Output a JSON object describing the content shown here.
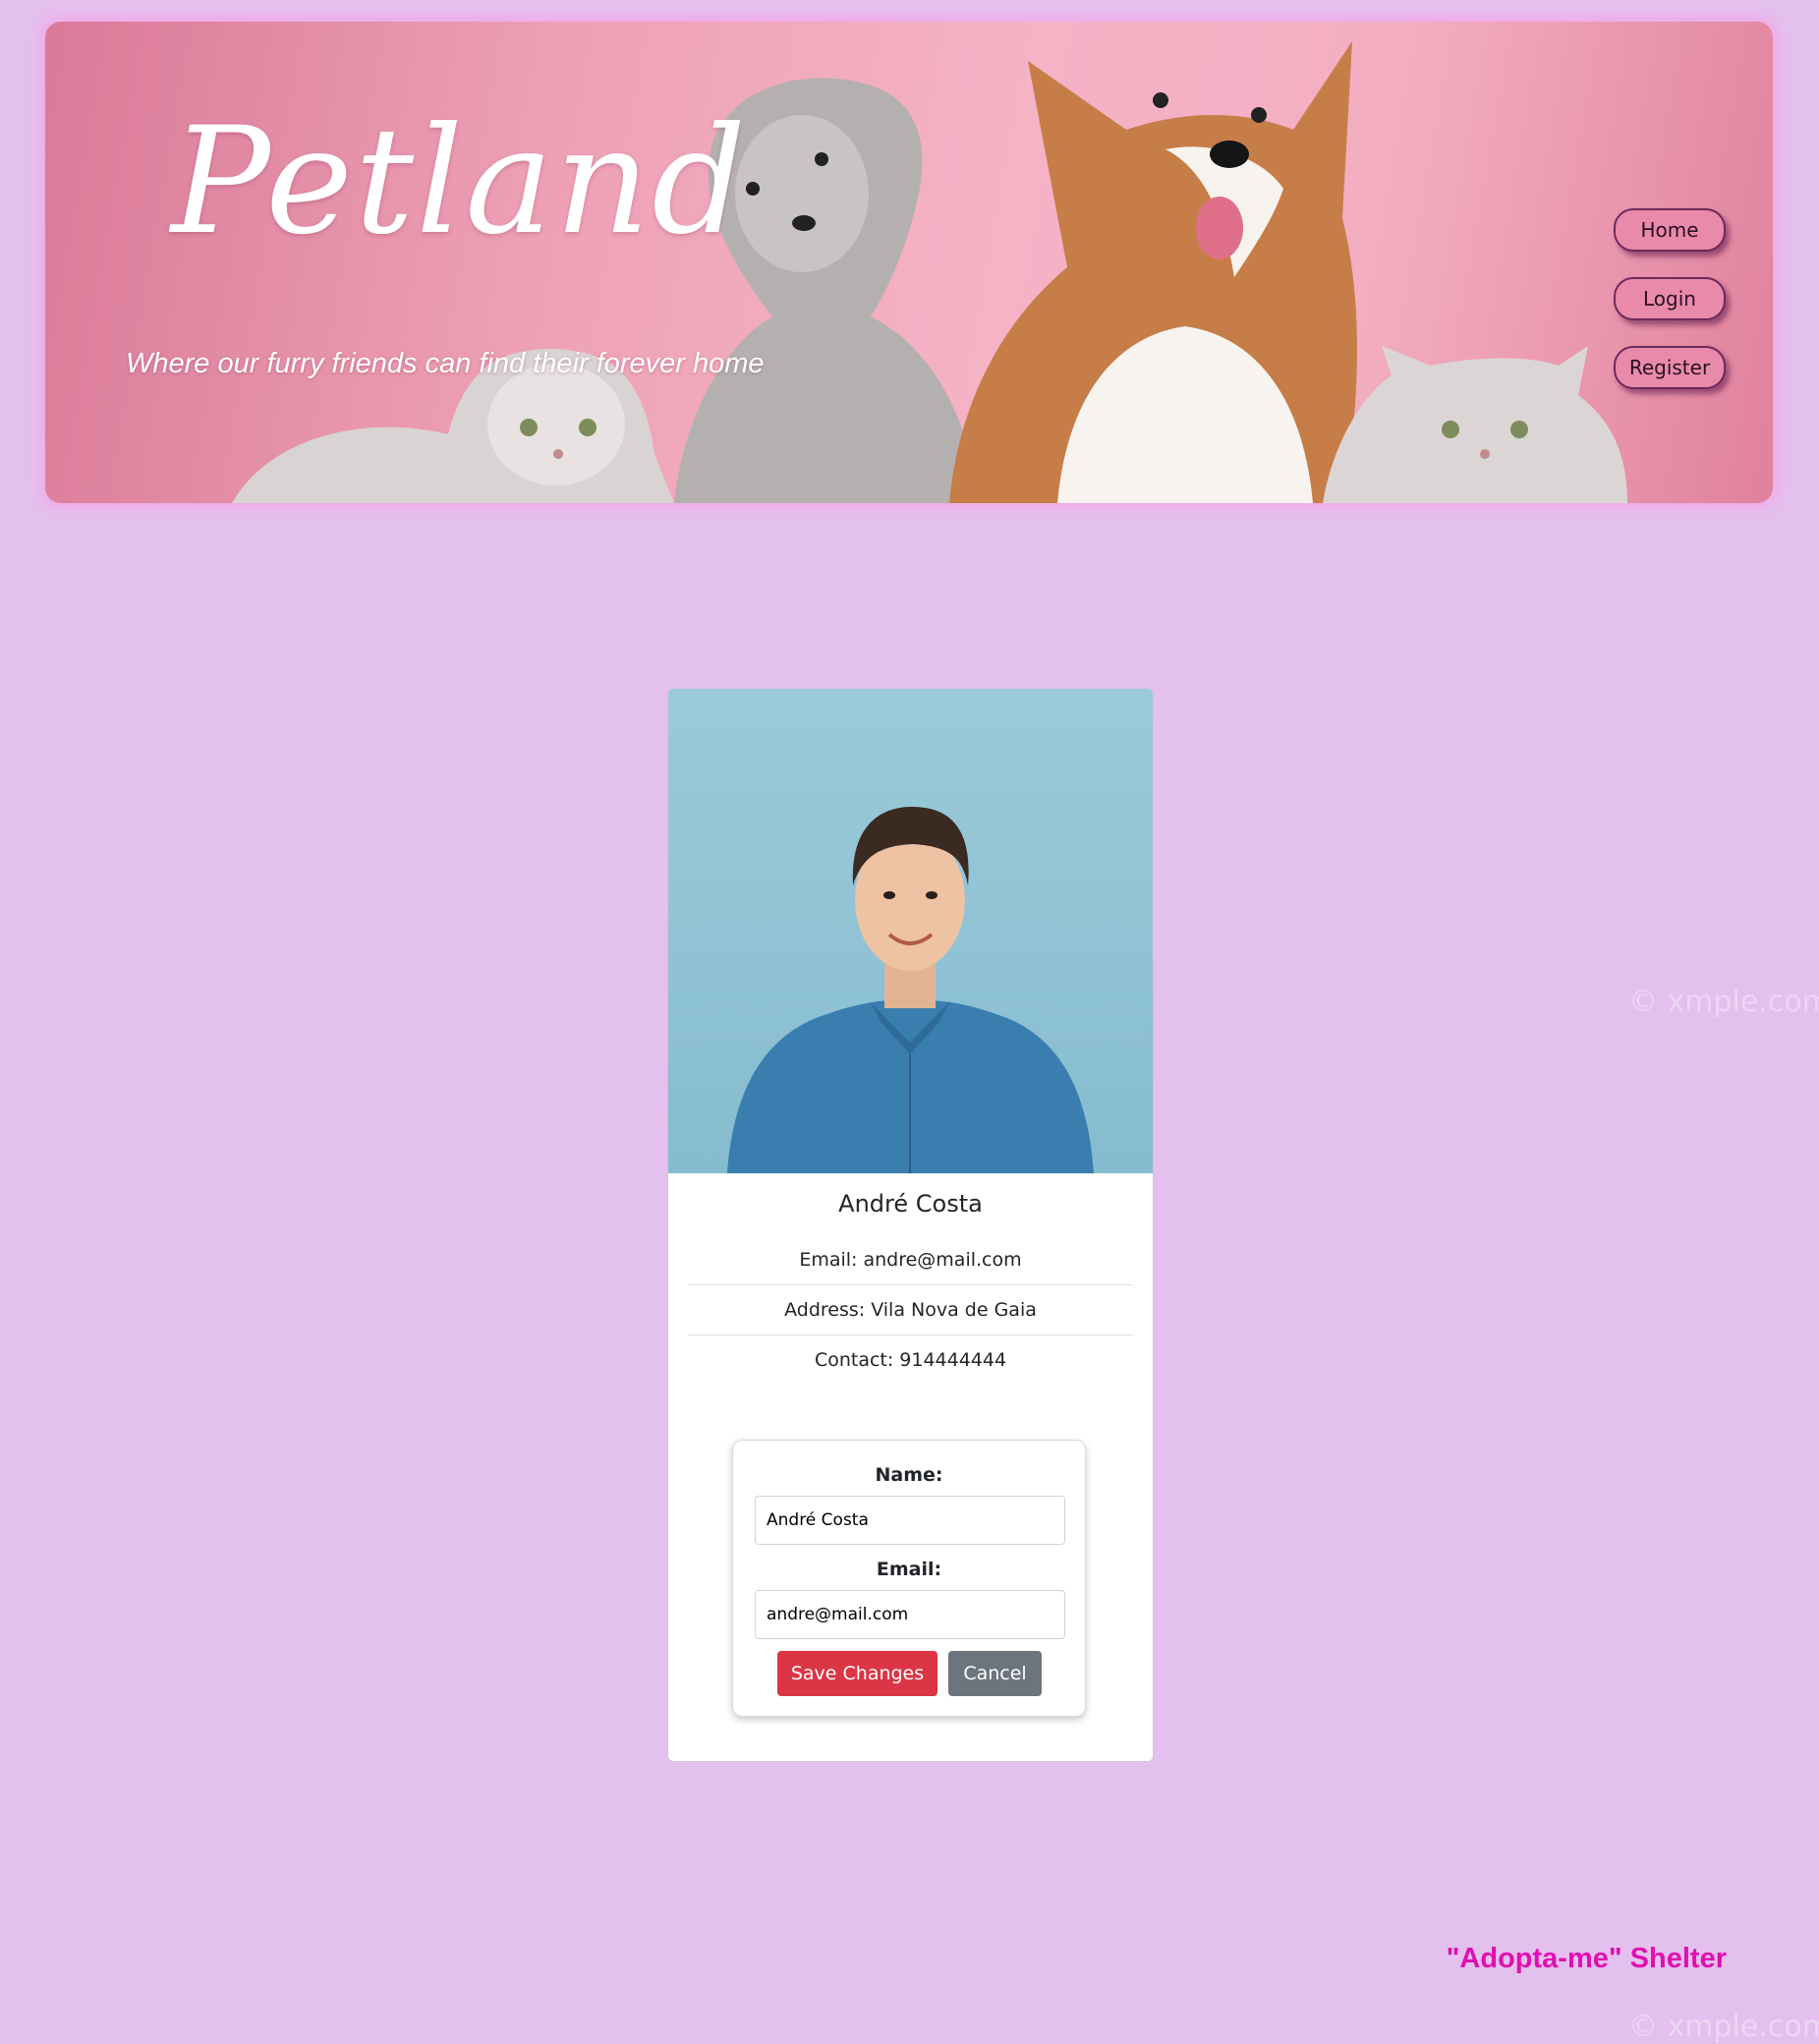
{
  "header": {
    "title": "Petland",
    "tagline": "Where our furry friends can find their forever home",
    "nav": [
      {
        "label": "Home"
      },
      {
        "label": "Login"
      },
      {
        "label": "Register"
      }
    ]
  },
  "profile": {
    "name": "André Costa",
    "details": [
      {
        "label": "Email:",
        "value": "andre@mail.com"
      },
      {
        "label": "Address:",
        "value": "Vila Nova de Gaia"
      },
      {
        "label": "Contact:",
        "value": "914444444"
      }
    ]
  },
  "edit_form": {
    "name_label": "Name:",
    "name_value": "André Costa",
    "email_label": "Email:",
    "email_value": "andre@mail.com",
    "save_label": "Save Changes",
    "cancel_label": "Cancel"
  },
  "footer": {
    "brand": "\"Adopta-me\" Shelter"
  },
  "watermark": {
    "text": "© xmple.com"
  },
  "colors": {
    "page_background": "#e4c0ee",
    "save_button": "#dc3545",
    "cancel_button": "#6c757d",
    "footer_brand": "#e010b0",
    "nav_button": "#e98aab"
  }
}
